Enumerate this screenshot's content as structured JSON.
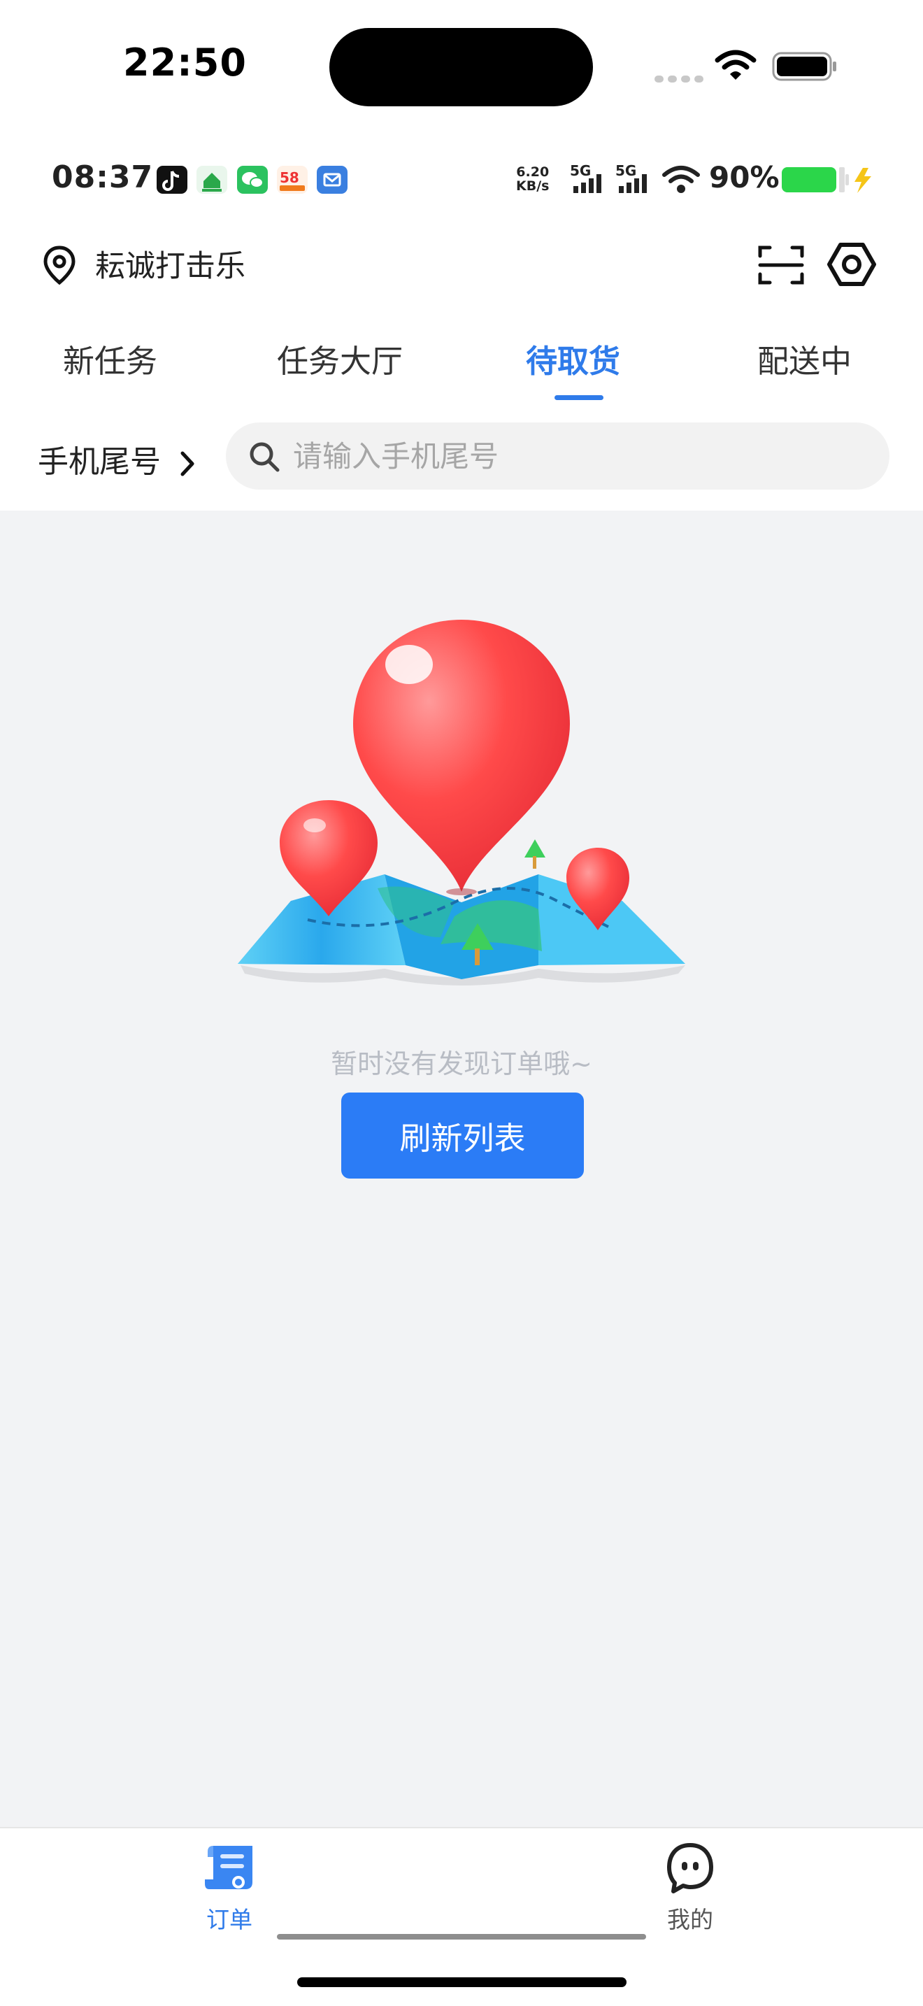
{
  "ios_status": {
    "time": "22:50"
  },
  "android_status": {
    "time": "08:37",
    "net_speed_value": "6.20",
    "net_speed_unit": "KB/s",
    "signal_1": "5G",
    "signal_2": "5G",
    "battery": "90%"
  },
  "header": {
    "location": "耘诚打击乐",
    "location_icon": "map-pin-icon",
    "scan_icon": "scan-icon",
    "settings_icon": "settings-icon"
  },
  "tabs": [
    {
      "label": "新任务",
      "active": false
    },
    {
      "label": "任务大厅",
      "active": false
    },
    {
      "label": "待取货",
      "active": true
    },
    {
      "label": "配送中",
      "active": false
    }
  ],
  "filter": {
    "label": "手机尾号",
    "placeholder": "请输入手机尾号",
    "value": ""
  },
  "empty_state": {
    "message": "暂时没有发现订单哦~",
    "button": "刷新列表"
  },
  "bottom_nav": [
    {
      "label": "订单",
      "icon": "order-scroll-icon",
      "active": true
    },
    {
      "label": "我的",
      "icon": "profile-face-icon",
      "active": false
    }
  ],
  "colors": {
    "accent": "#2f7bea",
    "button": "#2b7cf6",
    "background": "#f2f3f5"
  }
}
